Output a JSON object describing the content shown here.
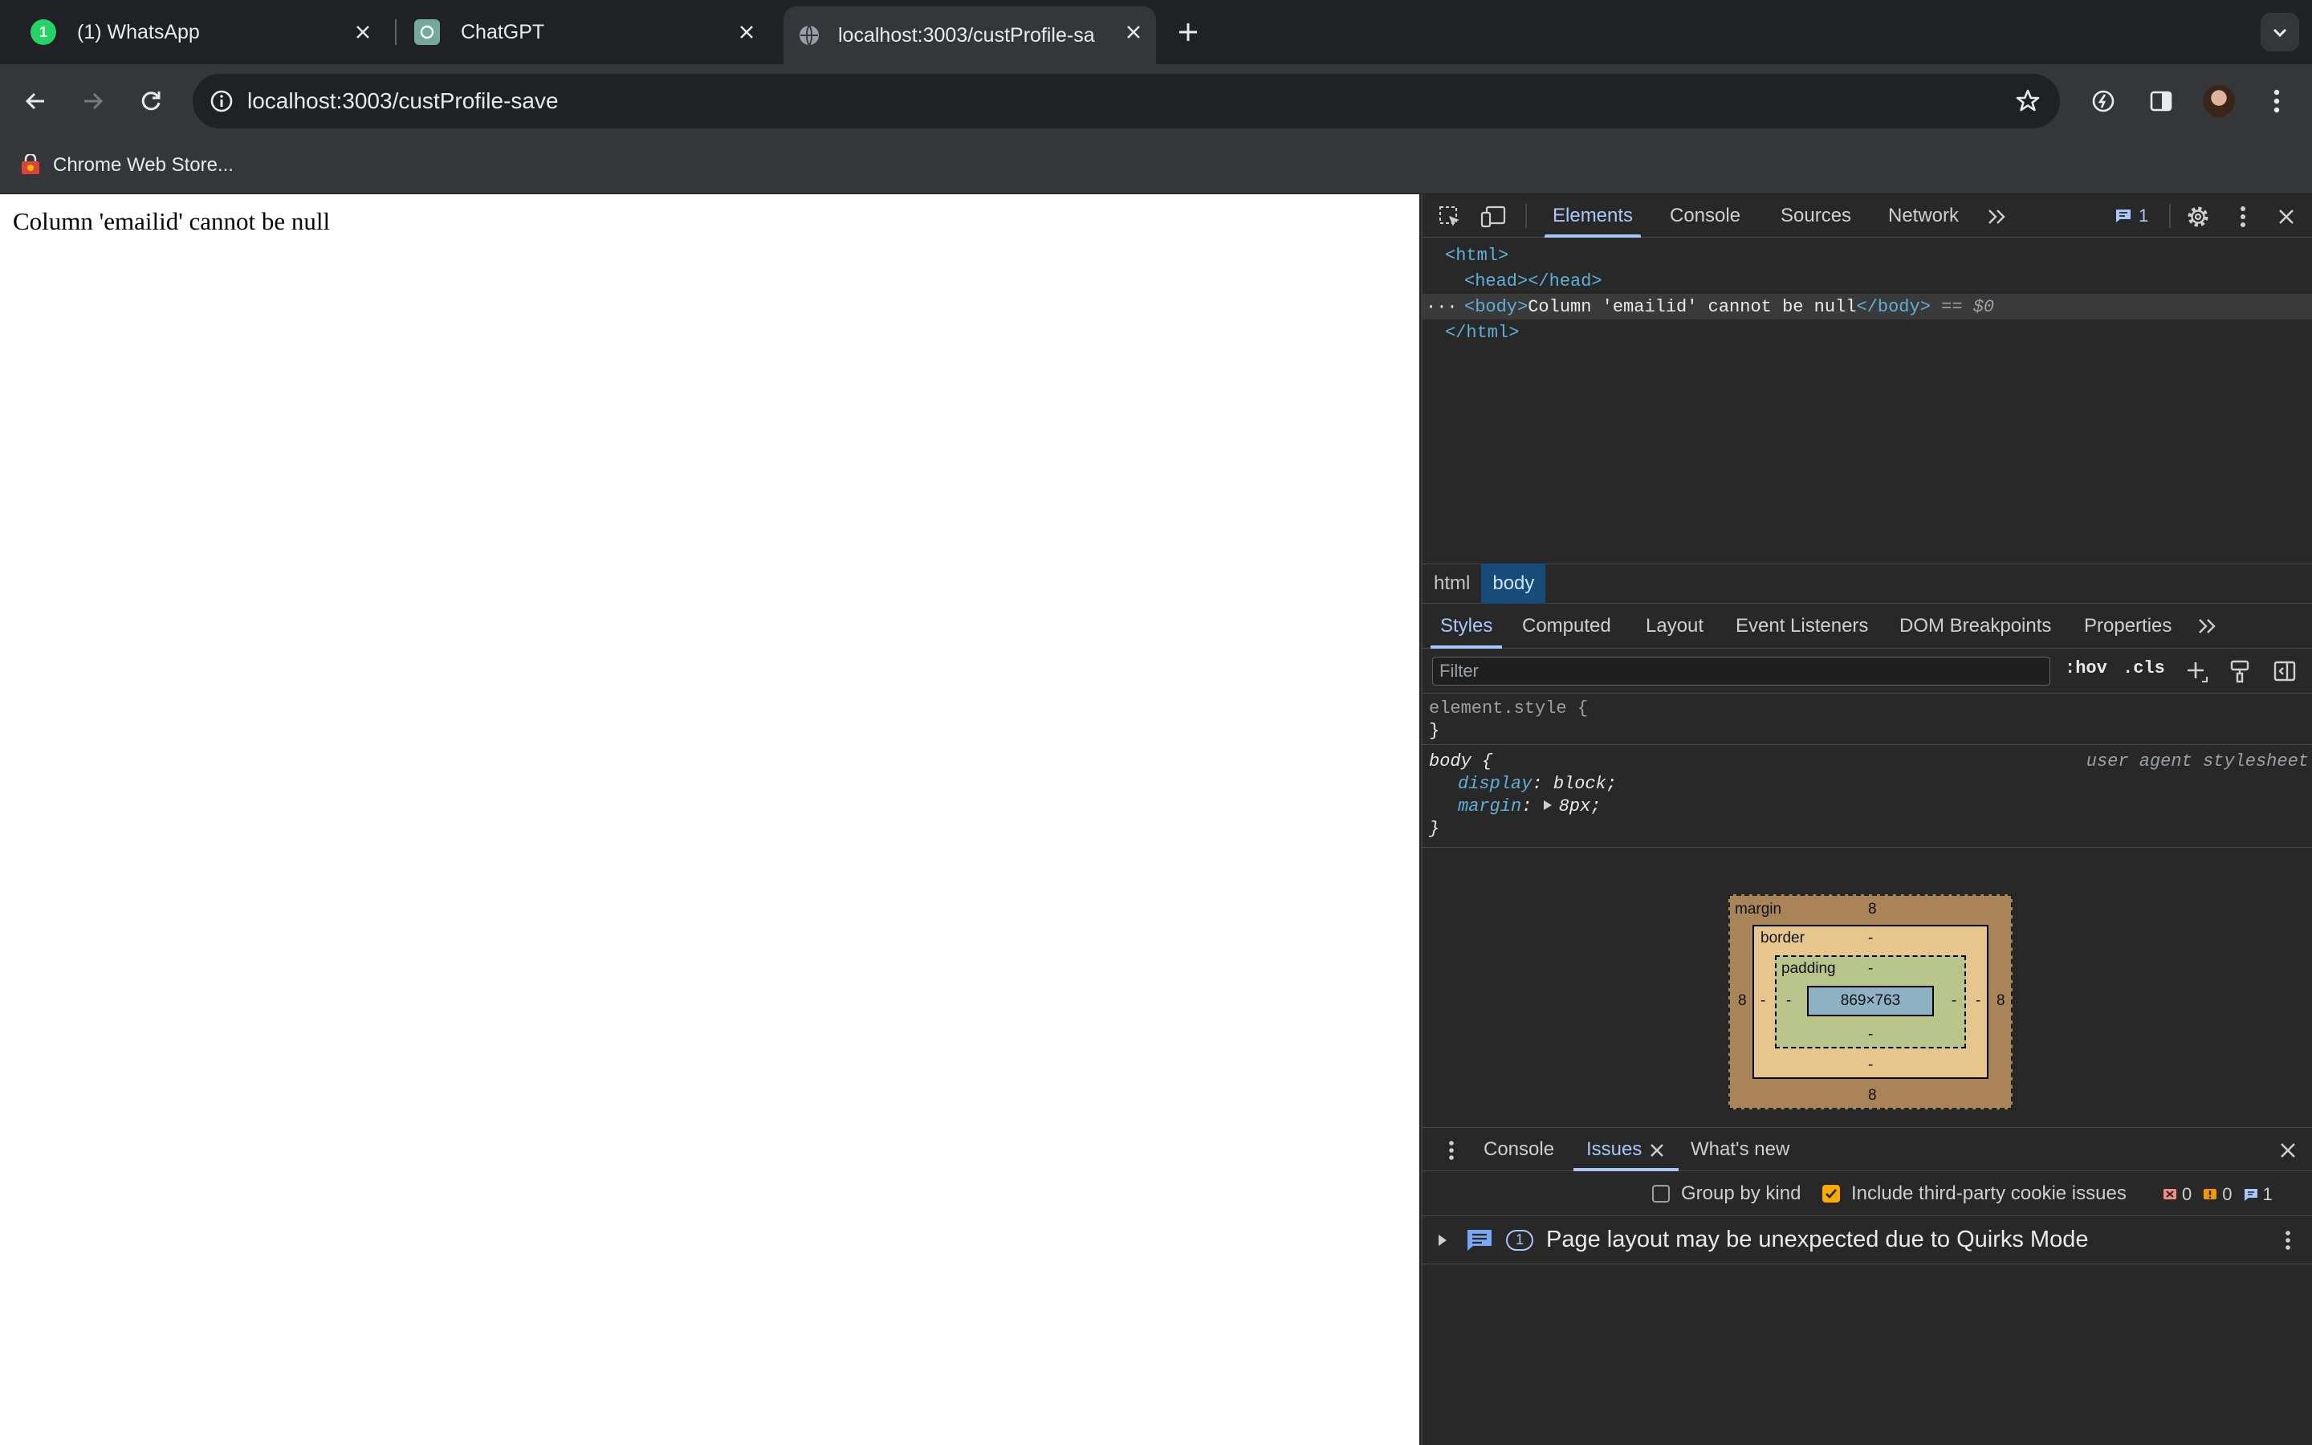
{
  "tabs": [
    {
      "title": "(1) WhatsApp",
      "badge": "1",
      "active": false
    },
    {
      "title": "ChatGPT",
      "active": false
    },
    {
      "title": "localhost:3003/custProfile-sa",
      "active": true
    }
  ],
  "toolbar": {
    "url": "localhost:3003/custProfile-save"
  },
  "bookmarks": [
    {
      "label": "Chrome Web Store..."
    }
  ],
  "page": {
    "body_text": "Column 'emailid' cannot be null"
  },
  "devtools": {
    "main_tabs": [
      "Elements",
      "Console",
      "Sources",
      "Network"
    ],
    "issues_badge": "1",
    "dom": {
      "html_open": "<html>",
      "head": "<head></head>",
      "body_open": "<body>",
      "body_text": "Column 'emailid' cannot be null",
      "body_close": "</body>",
      "eq": "== $0",
      "html_close": "</html>",
      "ellipsis": "···"
    },
    "breadcrumbs": [
      "html",
      "body"
    ],
    "styles_tabs": [
      "Styles",
      "Computed",
      "Layout",
      "Event Listeners",
      "DOM Breakpoints",
      "Properties"
    ],
    "filter_placeholder": "Filter",
    "hov": ":hov",
    "cls": ".cls",
    "rules": {
      "element_style": "element.style {",
      "close": "}",
      "body_selector": "body {",
      "source": "user agent stylesheet",
      "display_name": "display",
      "display_value": "block;",
      "margin_name": "margin",
      "margin_value": "8px;"
    },
    "box_model": {
      "margin_label": "margin",
      "margin_top": "8",
      "margin_bottom": "8",
      "margin_left": "8",
      "margin_right": "8",
      "border_label": "border",
      "border_top": "-",
      "border_bottom": "-",
      "border_left": "-",
      "border_right": "-",
      "padding_label": "padding",
      "padding_top": "-",
      "padding_bottom": "-",
      "padding_left": "-",
      "padding_right": "-",
      "content": "869×763"
    },
    "drawer": {
      "tabs": [
        "Console",
        "Issues",
        "What's new"
      ],
      "group_by_kind": "Group by kind",
      "include_third_party": "Include third-party cookie issues",
      "errors": "0",
      "warnings": "0",
      "info": "1",
      "issue_count": "1",
      "issue_message": "Page layout may be unexpected due to Quirks Mode"
    }
  },
  "colors": {
    "accent": "#a8c7fa",
    "tag": "#5db0d7",
    "warn": "#f9ab00"
  }
}
